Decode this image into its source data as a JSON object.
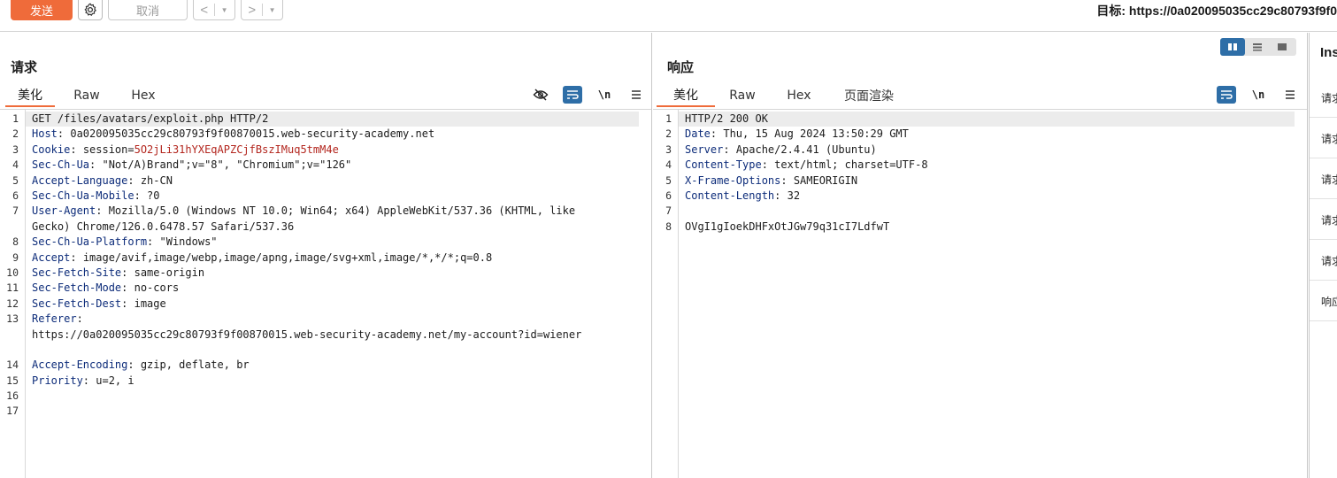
{
  "toolbar": {
    "send_label": "发送",
    "cancel_label": "取消",
    "back_label": "<",
    "forward_label": ">",
    "target_label": "目标: https://0a020095035cc29c80793f9f0"
  },
  "request": {
    "title": "请求",
    "tabs": [
      "美化",
      "Raw",
      "Hex"
    ],
    "newline_label": "\\n",
    "lines": [
      {
        "n": "1",
        "key": "",
        "sep": "",
        "val": "GET /files/avatars/exploit.php HTTP/2",
        "cookie": ""
      },
      {
        "n": "2",
        "key": "Host",
        "sep": ": ",
        "val": "0a020095035cc29c80793f9f00870015.web-security-academy.net",
        "cookie": ""
      },
      {
        "n": "3",
        "key": "Cookie",
        "sep": ": ",
        "val": "session=",
        "cookie": "5O2jLi31hYXEqAPZCjfBszIMuq5tmM4e"
      },
      {
        "n": "4",
        "key": "Sec-Ch-Ua",
        "sep": ": ",
        "val": "\"Not/A)Brand\";v=\"8\", \"Chromium\";v=\"126\"",
        "cookie": ""
      },
      {
        "n": "5",
        "key": "Accept-Language",
        "sep": ": ",
        "val": "zh-CN",
        "cookie": ""
      },
      {
        "n": "6",
        "key": "Sec-Ch-Ua-Mobile",
        "sep": ": ",
        "val": "?0",
        "cookie": ""
      },
      {
        "n": "7",
        "key": "User-Agent",
        "sep": ": ",
        "val": "Mozilla/5.0 (Windows NT 10.0; Win64; x64) AppleWebKit/537.36 (KHTML, like\nGecko) Chrome/126.0.6478.57 Safari/537.36",
        "cookie": "",
        "wrap": true
      },
      {
        "n": "8",
        "key": "Sec-Ch-Ua-Platform",
        "sep": ": ",
        "val": "\"Windows\"",
        "cookie": ""
      },
      {
        "n": "9",
        "key": "Accept",
        "sep": ": ",
        "val": "image/avif,image/webp,image/apng,image/svg+xml,image/*,*/*;q=0.8",
        "cookie": ""
      },
      {
        "n": "10",
        "key": "Sec-Fetch-Site",
        "sep": ": ",
        "val": "same-origin",
        "cookie": ""
      },
      {
        "n": "11",
        "key": "Sec-Fetch-Mode",
        "sep": ": ",
        "val": "no-cors",
        "cookie": ""
      },
      {
        "n": "12",
        "key": "Sec-Fetch-Dest",
        "sep": ": ",
        "val": "image",
        "cookie": ""
      },
      {
        "n": "13",
        "key": "Referer",
        "sep": ":",
        "val": "\nhttps://0a020095035cc29c80793f9f00870015.web-security-academy.net/my-account?id=wiener",
        "cookie": "",
        "wrap": true,
        "extra": true
      },
      {
        "n": "14",
        "key": "Accept-Encoding",
        "sep": ": ",
        "val": "gzip, deflate, br",
        "cookie": ""
      },
      {
        "n": "15",
        "key": "Priority",
        "sep": ": ",
        "val": "u=2, i",
        "cookie": ""
      },
      {
        "n": "16",
        "key": "",
        "sep": "",
        "val": "",
        "cookie": ""
      },
      {
        "n": "17",
        "key": "",
        "sep": "",
        "val": "",
        "cookie": ""
      }
    ]
  },
  "response": {
    "title": "响应",
    "tabs": [
      "美化",
      "Raw",
      "Hex",
      "页面渲染"
    ],
    "newline_label": "\\n",
    "lines": [
      {
        "n": "1",
        "key": "",
        "sep": "",
        "val": "HTTP/2 200 OK"
      },
      {
        "n": "2",
        "key": "Date",
        "sep": ": ",
        "val": "Thu, 15 Aug 2024 13:50:29 GMT"
      },
      {
        "n": "3",
        "key": "Server",
        "sep": ": ",
        "val": "Apache/2.4.41 (Ubuntu)"
      },
      {
        "n": "4",
        "key": "Content-Type",
        "sep": ": ",
        "val": "text/html; charset=UTF-8"
      },
      {
        "n": "5",
        "key": "X-Frame-Options",
        "sep": ": ",
        "val": "SAMEORIGIN"
      },
      {
        "n": "6",
        "key": "Content-Length",
        "sep": ": ",
        "val": "32"
      },
      {
        "n": "7",
        "key": "",
        "sep": "",
        "val": ""
      },
      {
        "n": "8",
        "key": "",
        "sep": "",
        "val": "OVgI1gIoekDHFxOtJGw79q31cI7LdfwT"
      }
    ]
  },
  "inspector": {
    "title": "Ins",
    "items": [
      "请求",
      "请求",
      "请求",
      "请求",
      "请求",
      "响应"
    ]
  },
  "colors": {
    "accent": "#ef6b3a",
    "active_tool": "#2e6ea7",
    "header_key": "#0d2c7a",
    "cookie_value": "#b3261e"
  }
}
